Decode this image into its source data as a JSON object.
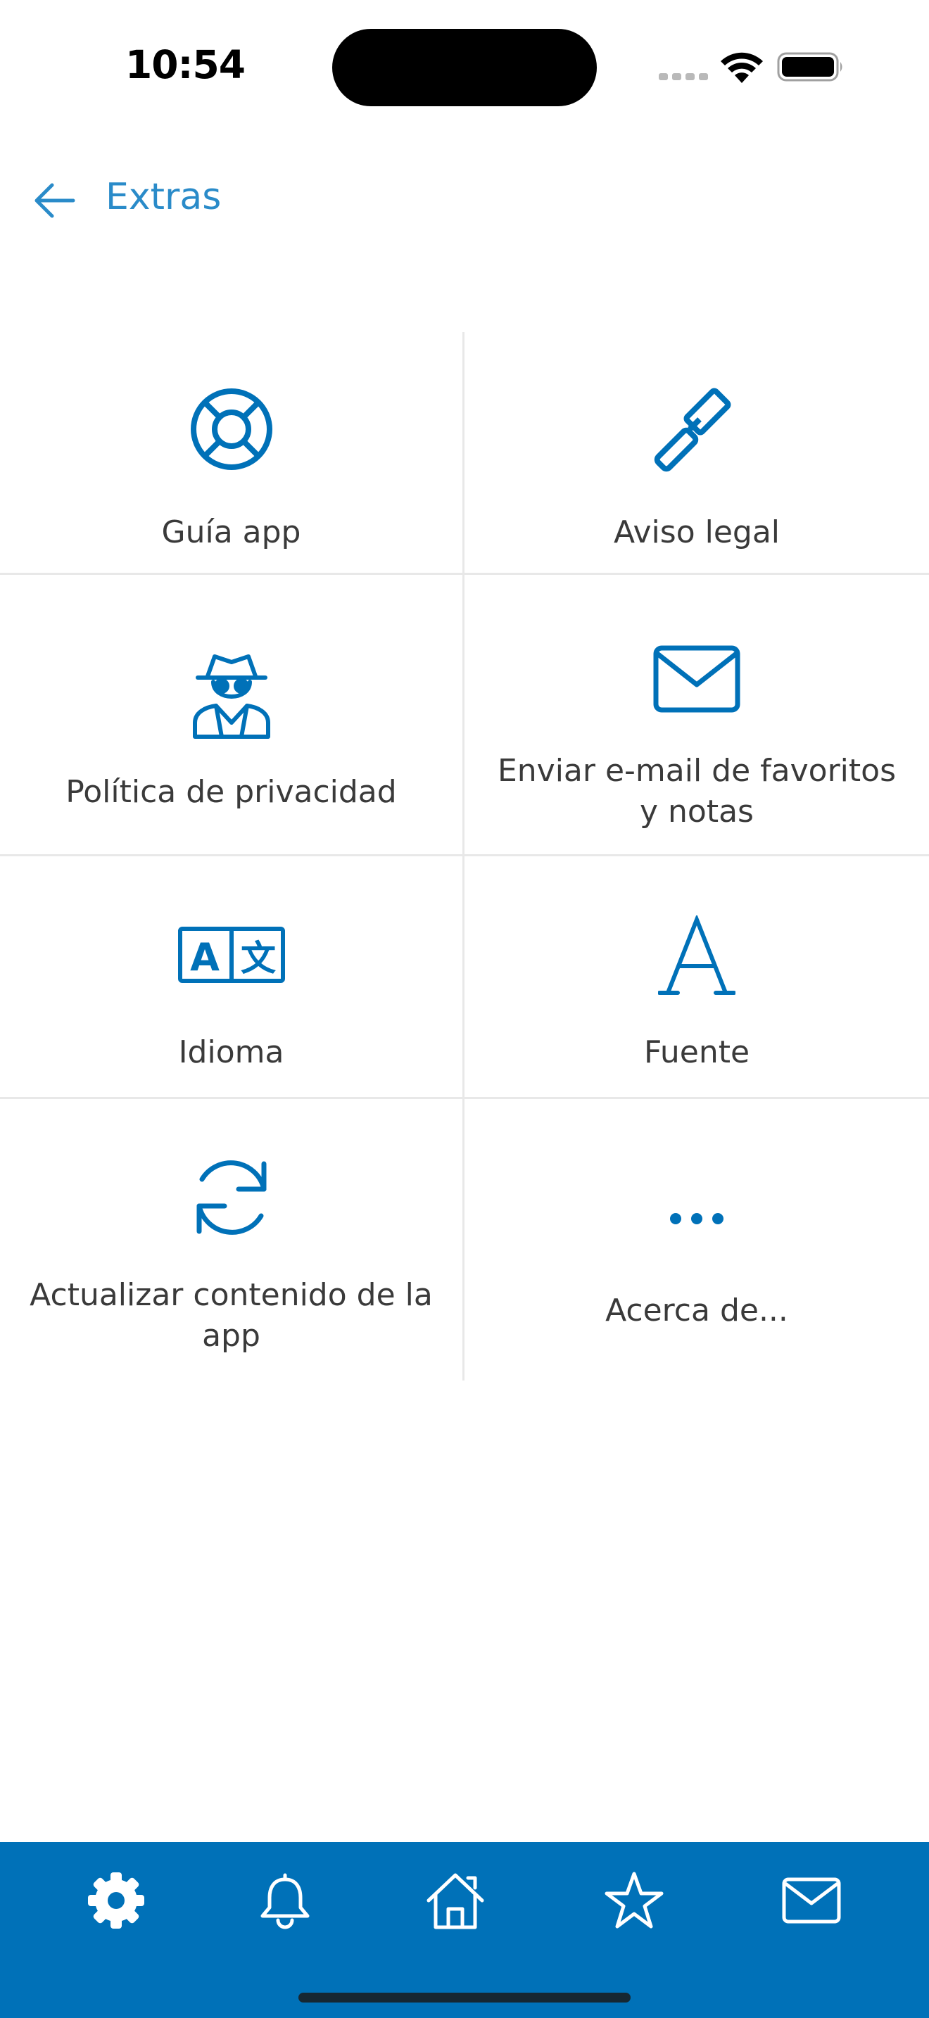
{
  "status": {
    "time": "10:54"
  },
  "header": {
    "title": "Extras",
    "back_icon": "arrow-left-icon"
  },
  "grid": {
    "items": [
      {
        "label": "Guía app",
        "icon": "life-ring-icon"
      },
      {
        "label": "Aviso legal",
        "icon": "gavel-icon"
      },
      {
        "label": "Política de privacidad",
        "icon": "spy-icon"
      },
      {
        "label": "Enviar e-mail de favoritos y notas",
        "icon": "envelope-icon"
      },
      {
        "label": "Idioma",
        "icon": "translate-icon"
      },
      {
        "label": "Fuente",
        "icon": "font-icon"
      },
      {
        "label": "Actualizar contenido de la app",
        "icon": "sync-icon"
      },
      {
        "label": "Acerca de...",
        "icon": "ellipsis-icon"
      }
    ]
  },
  "tabbar": {
    "tabs": [
      {
        "icon": "gear-icon",
        "active": true
      },
      {
        "icon": "bell-icon",
        "active": false
      },
      {
        "icon": "home-icon",
        "active": false
      },
      {
        "icon": "star-icon",
        "active": false
      },
      {
        "icon": "envelope-icon",
        "active": false
      }
    ]
  },
  "colors": {
    "accent": "#0071b8",
    "header_text": "#2a8bc9",
    "tabbar_bg": "#0071b8",
    "divider": "#e8e8e8"
  }
}
